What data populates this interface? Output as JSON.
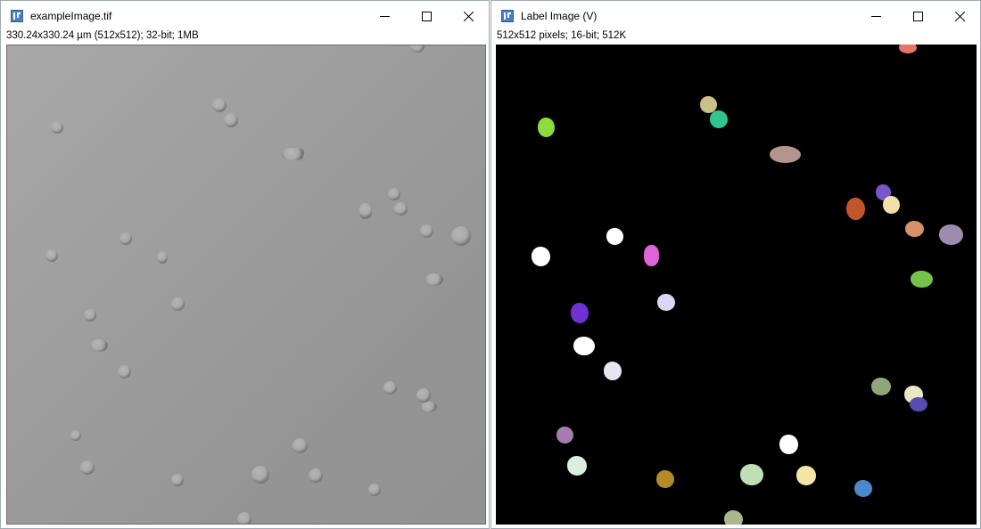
{
  "left_window": {
    "title": "exampleImage.tif",
    "info": "330.24x330.24 µm (512x512); 32-bit; 1MB",
    "icon": "imagej-icon",
    "canvas": "grayscale microscopy image of cells"
  },
  "right_window": {
    "title": "Label Image (V)",
    "info": "512x512 pixels; 16-bit; 512K",
    "icon": "imagej-icon",
    "canvas": "label image with colored cell regions on black background",
    "label_colors": [
      "#e8736b",
      "#c8c28a",
      "#2fc58e",
      "#8cdc3c",
      "#b4948c",
      "#7a56c8",
      "#c2552b",
      "#f5dfa9",
      "#d6906a",
      "#9e8bb0",
      "#ffffff",
      "#e064d8",
      "#ffffff",
      "#73c24a",
      "#d8d8f4",
      "#6f30d4",
      "#ffffff",
      "#e6e6f2",
      "#8fa57a",
      "#e8e8c4",
      "#5a4ab4",
      "#a77ab0",
      "#ffffff",
      "#daeee2",
      "#b38c28",
      "#bfe0b6",
      "#f2e6a4",
      "#4c89cc",
      "#a9b88c"
    ]
  },
  "controls": {
    "minimize": "minimize-icon",
    "maximize": "maximize-icon",
    "close": "close-icon"
  },
  "colors": {
    "window_border": "#9fa9b4",
    "title_bar": "#ffffff",
    "canvas_background_right": "#000000"
  }
}
